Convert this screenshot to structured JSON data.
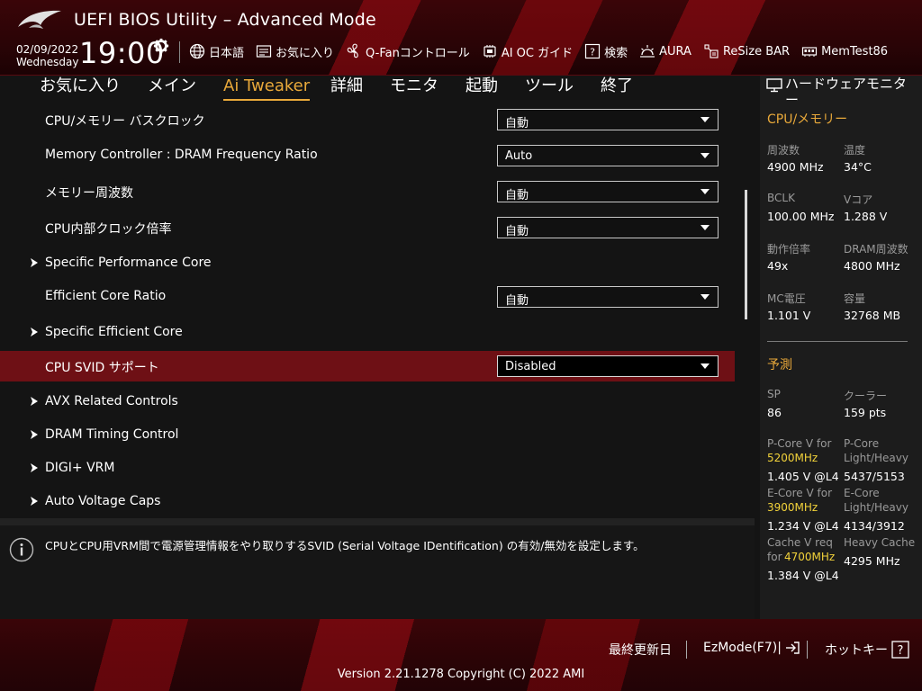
{
  "header": {
    "title": "UEFI BIOS Utility – Advanced Mode",
    "date": "02/09/2022",
    "weekday": "Wednesday",
    "time": "19:00",
    "toolbar": [
      {
        "name": "language-button",
        "icon": "globe-icon",
        "label": "日本語"
      },
      {
        "name": "favorites-button",
        "icon": "favorites-icon",
        "label": "お気に入り"
      },
      {
        "name": "qfan-control-button",
        "icon": "fan-icon",
        "label": "Q-Fanコントロール"
      },
      {
        "name": "ai-oc-guide-button",
        "icon": "oc-guide-icon",
        "label": "AI OC ガイド"
      },
      {
        "name": "search-button",
        "icon": "help-search-icon",
        "label": "検索"
      },
      {
        "name": "aura-button",
        "icon": "aura-icon",
        "label": "AURA"
      },
      {
        "name": "resize-bar-button",
        "icon": "resize-bar-icon",
        "label": "ReSize BAR"
      },
      {
        "name": "memtest-button",
        "icon": "memory-icon",
        "label": "MemTest86"
      }
    ]
  },
  "nav": {
    "tabs": [
      {
        "label": "お気に入り",
        "active": false
      },
      {
        "label": "メイン",
        "active": false
      },
      {
        "label": "Ai Tweaker",
        "active": true
      },
      {
        "label": "詳細",
        "active": false
      },
      {
        "label": "モニタ",
        "active": false
      },
      {
        "label": "起動",
        "active": false
      },
      {
        "label": "ツール",
        "active": false
      },
      {
        "label": "終了",
        "active": false
      }
    ]
  },
  "settings": [
    {
      "label": "CPU/メモリー バスクロック",
      "value": "自動",
      "submenu": false,
      "selected": false
    },
    {
      "label": "Memory Controller : DRAM Frequency Ratio",
      "value": "Auto",
      "submenu": false,
      "selected": false
    },
    {
      "label": "メモリー周波数",
      "value": "自動",
      "submenu": false,
      "selected": false
    },
    {
      "label": "CPU内部クロック倍率",
      "value": "自動",
      "submenu": false,
      "selected": false
    },
    {
      "label": "Specific Performance Core",
      "value": null,
      "submenu": true,
      "selected": false
    },
    {
      "label": "Efficient Core Ratio",
      "value": "自動",
      "submenu": false,
      "selected": false
    },
    {
      "label": "Specific Efficient Core",
      "value": null,
      "submenu": true,
      "selected": false
    },
    {
      "label": "CPU SVID サポート",
      "value": "Disabled",
      "submenu": false,
      "selected": true
    },
    {
      "label": "AVX Related Controls",
      "value": null,
      "submenu": true,
      "selected": false
    },
    {
      "label": "DRAM Timing Control",
      "value": null,
      "submenu": true,
      "selected": false
    },
    {
      "label": "DIGI+ VRM",
      "value": null,
      "submenu": true,
      "selected": false
    },
    {
      "label": "Auto Voltage Caps",
      "value": null,
      "submenu": true,
      "selected": false
    }
  ],
  "help": {
    "text": "CPUとCPU用VRM間で電源管理情報をやり取りするSVID (Serial Voltage IDentification) の有効/無効を設定します。"
  },
  "hw_monitor": {
    "title": "ハードウェアモニター",
    "cpu_mem_section": "CPU/メモリー",
    "cpu_mem": [
      {
        "label": "周波数",
        "value": "4900 MHz"
      },
      {
        "label": "温度",
        "value": "34°C"
      },
      {
        "label": "BCLK",
        "value": "100.00 MHz"
      },
      {
        "label": "Vコア",
        "value": "1.288 V"
      },
      {
        "label": "動作倍率",
        "value": "49x"
      },
      {
        "label": "DRAM周波数",
        "value": "4800 MHz"
      },
      {
        "label": "MC電圧",
        "value": "1.101 V"
      },
      {
        "label": "容量",
        "value": "32768 MB"
      }
    ],
    "predict_section": "予測",
    "predict": {
      "sp_label": "SP",
      "sp_value": "86",
      "cooler_label": "クーラー",
      "cooler_value": "159 pts",
      "pcore_v_label": "P-Core V for",
      "pcore_v_freq": "5200MHz",
      "pcore_v_value": "1.405 V @L4",
      "pcore_lh_label1": "P-Core",
      "pcore_lh_label2": "Light/Heavy",
      "pcore_lh_value": "5437/5153",
      "ecore_v_label": "E-Core V for",
      "ecore_v_freq": "3900MHz",
      "ecore_v_value": "1.234 V @L4",
      "ecore_lh_label1": "E-Core",
      "ecore_lh_label2": "Light/Heavy",
      "ecore_lh_value": "4134/3912",
      "cache_v_label1": "Cache V req",
      "cache_v_label2": "for",
      "cache_v_freq": "4700MHz",
      "cache_v_value": "1.384 V @L4",
      "heavy_cache_label": "Heavy Cache",
      "heavy_cache_value": "4295 MHz"
    }
  },
  "footer": {
    "last_modified": "最終更新日",
    "ezmode": "EzMode(F7)|",
    "hotkeys": "ホットキー",
    "version": "Version 2.21.1278 Copyright (C) 2022 AMI"
  },
  "colors": {
    "accent": "#e9a93a",
    "highlight_row": "#6e1015",
    "header_red": "#3a0508",
    "freq_highlight": "#f2d23a"
  }
}
